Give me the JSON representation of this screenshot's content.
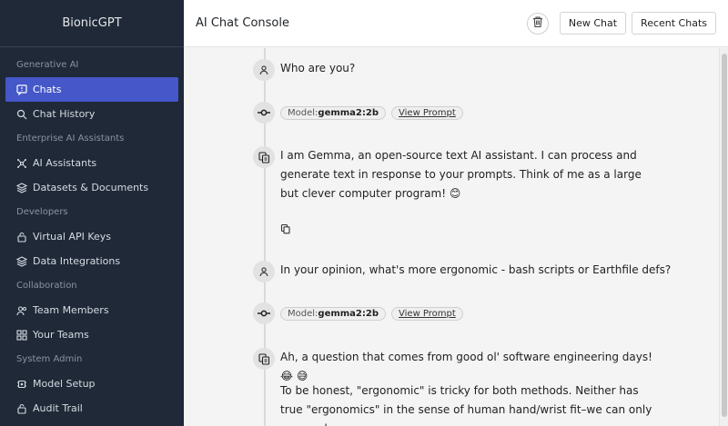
{
  "sidebar": {
    "brand": "BionicGPT",
    "sections": [
      {
        "label": "Generative AI",
        "items": [
          {
            "label": "Chats",
            "icon": "chat-icon",
            "active": true
          },
          {
            "label": "Chat History",
            "icon": "search-icon",
            "active": false
          }
        ]
      },
      {
        "label": "Enterprise AI Assistants",
        "items": [
          {
            "label": "AI Assistants",
            "icon": "network-icon",
            "active": false
          },
          {
            "label": "Datasets & Documents",
            "icon": "layers-icon",
            "active": false
          }
        ]
      },
      {
        "label": "Developers",
        "items": [
          {
            "label": "Virtual API Keys",
            "icon": "lock-icon",
            "active": false
          },
          {
            "label": "Data Integrations",
            "icon": "layers-icon",
            "active": false
          }
        ]
      },
      {
        "label": "Collaboration",
        "items": [
          {
            "label": "Team Members",
            "icon": "users-icon",
            "active": false
          },
          {
            "label": "Your Teams",
            "icon": "grid-icon",
            "active": false
          }
        ]
      },
      {
        "label": "System Admin",
        "items": [
          {
            "label": "Model Setup",
            "icon": "model-icon",
            "active": false
          },
          {
            "label": "Audit Trail",
            "icon": "lock-icon",
            "active": false
          }
        ]
      }
    ]
  },
  "header": {
    "title": "AI Chat Console",
    "delete_icon": "trash-icon",
    "new_chat": "New Chat",
    "recent_chats": "Recent Chats"
  },
  "chat": {
    "messages": [
      {
        "role": "user",
        "text": "Who are you?"
      },
      {
        "role": "model",
        "model_label": "Model:",
        "model_name": "gemma2:2b",
        "view_prompt": "View Prompt"
      },
      {
        "role": "assistant",
        "text": "I am Gemma, an open-source text AI assistant. I can process and generate text in response to your prompts. Think of me as a large but clever computer program! 😊"
      },
      {
        "role": "user",
        "text": "In your opinion, what's more ergonomic - bash scripts or Earthfile defs?"
      },
      {
        "role": "model",
        "model_label": "Model:",
        "model_name": "gemma2:2b",
        "view_prompt": "View Prompt"
      },
      {
        "role": "assistant",
        "text": "Ah, a question that comes from good ol' software engineering days! 😂 😅"
      },
      {
        "role": "assistant-continued",
        "text": "To be honest, \"ergonomic\" is tricky for both methods. Neither has true \"ergonomics\" in the sense of human hand/wrist fit–we can only approach"
      }
    ]
  },
  "colors": {
    "sidebar_bg": "#1f2937",
    "active_item": "#4557c9",
    "page_bg": "#f4f4f4"
  }
}
